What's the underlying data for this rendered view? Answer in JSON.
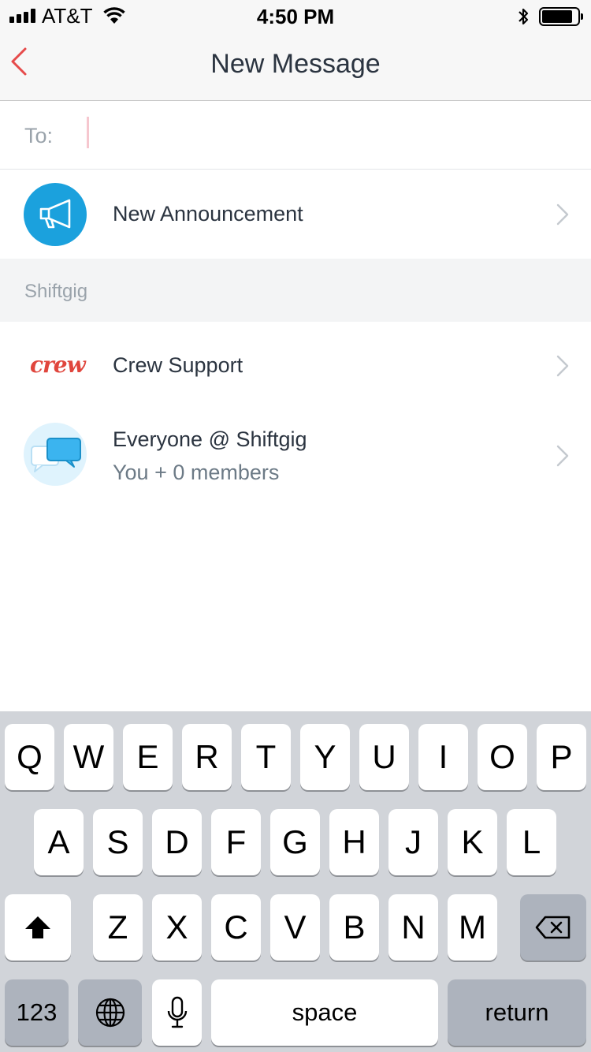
{
  "status_bar": {
    "carrier": "AT&T",
    "time": "4:50 PM",
    "icons": [
      "signal-icon",
      "wifi-icon",
      "bluetooth-icon",
      "battery-icon"
    ]
  },
  "nav": {
    "title": "New Message",
    "back_icon": "chevron-left-icon",
    "accent_color": "#e64a4a"
  },
  "to_field": {
    "label": "To:",
    "value": ""
  },
  "announcement": {
    "title": "New Announcement",
    "icon": "megaphone-icon",
    "icon_color": "#1ba1dd"
  },
  "section": {
    "title": "Shiftgig"
  },
  "conversations": [
    {
      "title": "Crew Support",
      "logo_text": "crew",
      "logo_color": "#e0463d"
    },
    {
      "title": "Everyone @ Shiftgig",
      "subtitle": "You + 0 members",
      "icon": "chat-bubbles-icon"
    }
  ],
  "keyboard": {
    "row1": [
      "Q",
      "W",
      "E",
      "R",
      "T",
      "Y",
      "U",
      "I",
      "O",
      "P"
    ],
    "row2": [
      "A",
      "S",
      "D",
      "F",
      "G",
      "H",
      "J",
      "K",
      "L"
    ],
    "row3": [
      "Z",
      "X",
      "C",
      "V",
      "B",
      "N",
      "M"
    ],
    "numbers_label": "123",
    "space_label": "space",
    "return_label": "return",
    "icons": [
      "shift-icon",
      "backspace-icon",
      "globe-icon",
      "microphone-icon"
    ]
  }
}
